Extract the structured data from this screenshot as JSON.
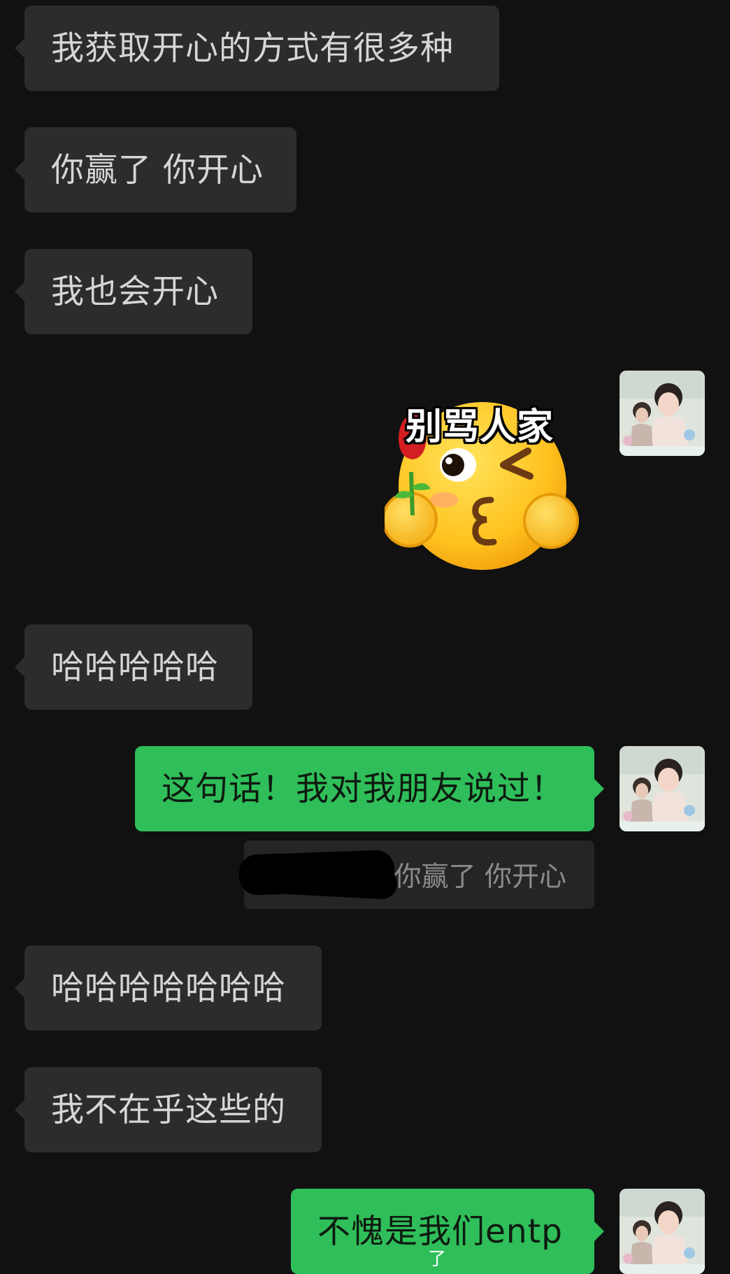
{
  "messages": {
    "m1": "我获取开心的方式有很多种",
    "m2": "你赢了 你开心",
    "m3": "我也会开心",
    "sticker": "别骂人家",
    "m4": "哈哈哈哈哈",
    "m5": "这句话！我对我朋友说过！",
    "quote": "你赢了 你开心",
    "m6": "哈哈哈哈哈哈哈",
    "m7": "我不在乎这些的",
    "m8": "不愧是我们entp",
    "overlay": "了"
  },
  "colors": {
    "background": "#111111",
    "incoming_bubble": "#2c2c2c",
    "outgoing_bubble": "#2fbe59"
  },
  "icons": {
    "avatar": "avatar-photo",
    "sticker": "kiss-wink-emoji-with-rose"
  }
}
